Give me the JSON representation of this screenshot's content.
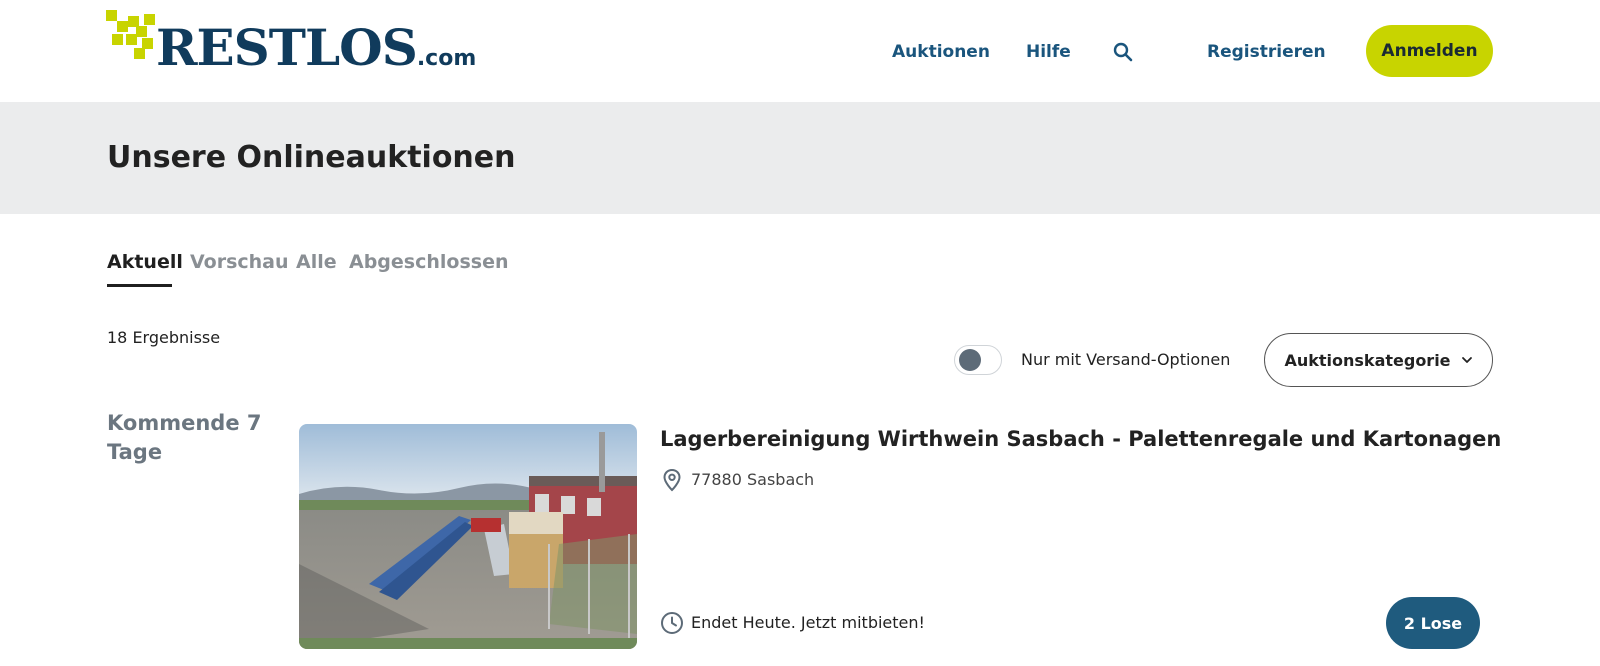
{
  "brand": {
    "logo_main": "RESTLOS",
    "logo_suffix": ".com",
    "accent_color": "#c8d400",
    "primary_color": "#103b5c"
  },
  "nav": {
    "auktionen": "Auktionen",
    "hilfe": "Hilfe",
    "search_icon": "search-icon",
    "registrieren": "Registrieren",
    "anmelden": "Anmelden"
  },
  "page": {
    "title": "Unsere Onlineauktionen"
  },
  "tabs": [
    {
      "label": "Aktuell",
      "active": true
    },
    {
      "label": "Vorschau",
      "active": false
    },
    {
      "label": "Alle",
      "active": false
    },
    {
      "label": "Abgeschlossen",
      "active": false
    }
  ],
  "filters": {
    "results_count": "18 Ergebnisse",
    "shipping_toggle_label": "Nur mit Versand-Optionen",
    "shipping_toggle_on": false,
    "category_button": "Auktionskategorie"
  },
  "groups": [
    {
      "label": "Kommende 7 Tage",
      "auctions": [
        {
          "title": "Lagerbereinigung Wirthwein Sasbach - Palettenregale und Kartonagen",
          "location": "77880 Sasbach",
          "ends": "Endet Heute. Jetzt mitbieten!",
          "lots": "2 Lose"
        }
      ]
    }
  ]
}
